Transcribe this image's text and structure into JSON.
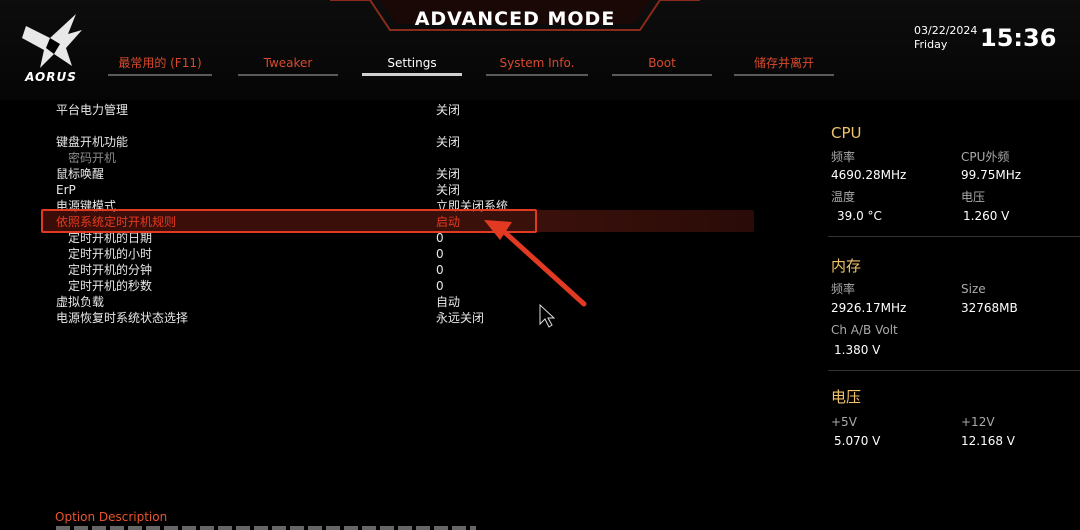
{
  "header": {
    "brand": "AORUS",
    "mode_title": "ADVANCED MODE",
    "date": "03/22/2024",
    "weekday": "Friday",
    "time": "15:36"
  },
  "tabs": [
    {
      "label": "最常用的 (F11)",
      "active": false
    },
    {
      "label": "Tweaker",
      "active": false
    },
    {
      "label": "Settings",
      "active": true
    },
    {
      "label": "System Info.",
      "active": false
    },
    {
      "label": "Boot",
      "active": false
    },
    {
      "label": "储存并离开",
      "active": false
    }
  ],
  "settings": [
    {
      "label": "平台电力管理",
      "value": "关闭"
    },
    {
      "label": "键盘开机功能",
      "value": "关闭"
    },
    {
      "label": "密码开机",
      "value": ""
    },
    {
      "label": "鼠标唤醒",
      "value": "关闭"
    },
    {
      "label": "ErP",
      "value": "关闭"
    },
    {
      "label": "电源键模式",
      "value": "立即关闭系统"
    },
    {
      "label": "依照系统定时开机规则",
      "value": "启动"
    },
    {
      "label": "定时开机的日期",
      "value": "0"
    },
    {
      "label": "定时开机的小时",
      "value": "0"
    },
    {
      "label": "定时开机的分钟",
      "value": "0"
    },
    {
      "label": "定时开机的秒数",
      "value": "0"
    },
    {
      "label": "虚拟负载",
      "value": "自动"
    },
    {
      "label": "电源恢复时系统状态选择",
      "value": "永远关闭"
    }
  ],
  "panel": {
    "cpu": {
      "title": "CPU",
      "freq_label": "频率",
      "freq_value": "4690.28MHz",
      "bclk_label": "CPU外频",
      "bclk_value": "99.75MHz",
      "temp_label": "温度",
      "temp_value": "39.0 °C",
      "volt_label": "电压",
      "volt_value": "1.260 V"
    },
    "memory": {
      "title": "内存",
      "freq_label": "频率",
      "freq_value": "2926.17MHz",
      "size_label": "Size",
      "size_value": "32768MB",
      "volt_label": "Ch A/B Volt",
      "volt_value": "1.380 V"
    },
    "voltage": {
      "title": "电压",
      "v5_label": "+5V",
      "v5_value": "5.070 V",
      "v12_label": "+12V",
      "v12_value": "12.168 V"
    }
  },
  "footer": {
    "description_label": "Option Description"
  },
  "colors": {
    "accent": "#e53a1e",
    "section_title": "#f0c46a",
    "tab_inactive": "#d84a2c"
  }
}
